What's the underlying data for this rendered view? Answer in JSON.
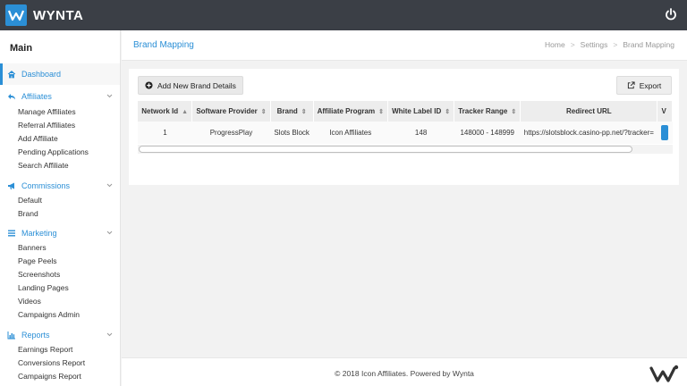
{
  "app": {
    "name": "WYNTA"
  },
  "sidebar": {
    "title": "Main",
    "dashboard": "Dashboard",
    "sections": [
      {
        "label": "Affiliates",
        "items": [
          "Manage Affiliates",
          "Referral Affiliates",
          "Add Affiliate",
          "Pending Applications",
          "Search Affiliate"
        ]
      },
      {
        "label": "Commissions",
        "items": [
          "Default",
          "Brand"
        ]
      },
      {
        "label": "Marketing",
        "items": [
          "Banners",
          "Page Peels",
          "Screenshots",
          "Landing Pages",
          "Videos",
          "Campaigns Admin"
        ]
      },
      {
        "label": "Reports",
        "items": [
          "Earnings Report",
          "Conversions Report",
          "Campaigns Report"
        ]
      }
    ]
  },
  "header": {
    "title": "Brand Mapping",
    "breadcrumb": [
      "Home",
      "Settings",
      "Brand Mapping"
    ]
  },
  "toolbar": {
    "add_label": "Add New Brand Details",
    "export_label": "Export"
  },
  "table": {
    "columns": [
      "Network Id",
      "Software Provider",
      "Brand",
      "Affiliate Program",
      "White Label ID",
      "Tracker Range",
      "Redirect URL",
      "V"
    ],
    "rows": [
      [
        "1",
        "ProgressPlay",
        "Slots Block",
        "Icon Affiliates",
        "148",
        "148000 - 148999",
        "https://slotsblock.casino-pp.net/?tracker="
      ]
    ]
  },
  "footer": {
    "text": "© 2018 Icon Affiliates. Powered by Wynta"
  },
  "colors": {
    "accent": "#2b8fd6",
    "topbar": "#3b3f46"
  }
}
